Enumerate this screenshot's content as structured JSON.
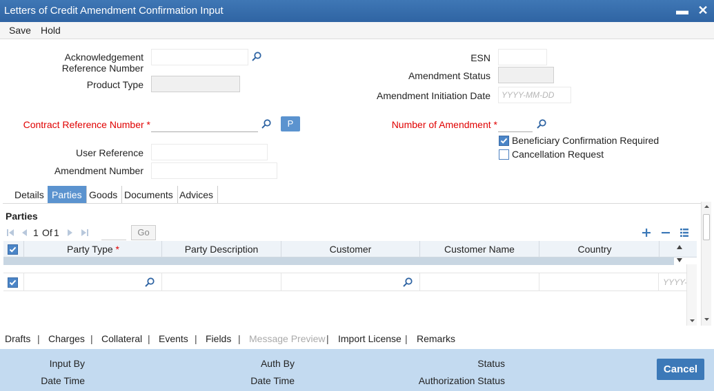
{
  "window": {
    "title": "Letters of Credit Amendment Confirmation Input",
    "minimize": "▬",
    "close": "✕"
  },
  "menu": {
    "save": "Save",
    "hold": "Hold"
  },
  "form": {
    "ack_ref_label": "Acknowledgement Reference Number",
    "product_type_label": "Product Type",
    "esn_label": "ESN",
    "amendment_status_label": "Amendment Status",
    "amendment_init_date_label": "Amendment Initiation Date",
    "amendment_init_date_placeholder": "YYYY-MM-DD",
    "contract_ref_label": "Contract Reference Number",
    "p_button": "P",
    "number_of_amendment_label": "Number of Amendment",
    "beneficiary_confirmation_label": "Beneficiary Confirmation Required",
    "beneficiary_confirmation_checked": true,
    "cancellation_request_label": "Cancellation Request",
    "cancellation_request_checked": false,
    "user_reference_label": "User Reference",
    "amendment_number_label": "Amendment Number",
    "required_marker": "*"
  },
  "tabs": [
    {
      "label": "Details",
      "active": false
    },
    {
      "label": "Parties",
      "active": true
    },
    {
      "label": "Goods",
      "active": false
    },
    {
      "label": "Documents",
      "active": false
    },
    {
      "label": "Advices",
      "active": false
    }
  ],
  "parties": {
    "section_title": "Parties",
    "pager": {
      "current": "1",
      "of_label": "Of",
      "total": "1",
      "go_label": "Go"
    },
    "columns": {
      "party_type": "Party Type",
      "party_description": "Party Description",
      "customer": "Customer",
      "customer_name": "Customer Name",
      "country": "Country"
    },
    "row_date_placeholder": "YYYY-"
  },
  "subsystems": [
    "Drafts",
    "Charges",
    "Collateral",
    "Events",
    "Fields",
    "Message Preview",
    "Import License",
    "Remarks"
  ],
  "subsystem_disabled": "Message Preview",
  "footer": {
    "input_by": "Input By",
    "date_time_1": "Date Time",
    "auth_by": "Auth By",
    "date_time_2": "Date Time",
    "status": "Status",
    "authorization_status": "Authorization Status",
    "cancel": "Cancel"
  },
  "colors": {
    "title_bar": "#3f77b5",
    "accent": "#5b93cf",
    "required": "#e00000",
    "footer": "#c3daf0"
  }
}
